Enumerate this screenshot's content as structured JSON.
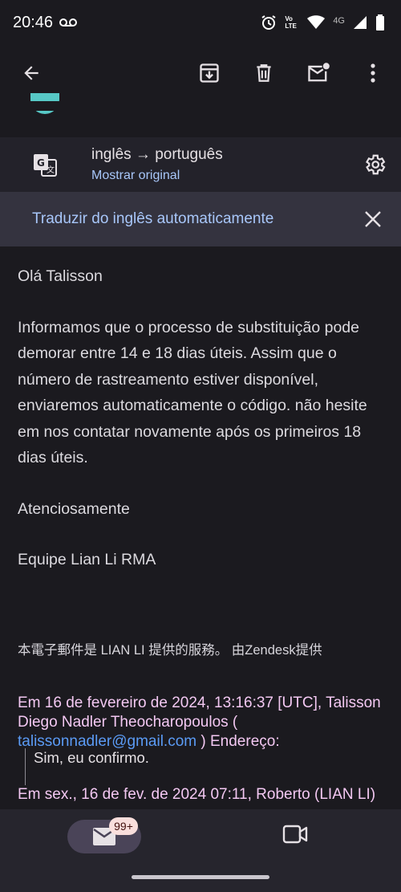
{
  "status_bar": {
    "time": "20:46",
    "network": "4G",
    "volte": "Vo LTE"
  },
  "translation": {
    "languages": "inglês → português",
    "show_original": "Mostrar original",
    "auto_translate": "Traduzir do inglês automaticamente"
  },
  "message": {
    "greeting": "Olá Talisson",
    "paragraph": "Informamos que o processo de substituição pode demorar entre 14 e 18 dias úteis. Assim que o número de rastreamento estiver disponível, enviaremos automaticamente o código. não hesite em nos contatar novamente após os primeiros 18 dias úteis.",
    "closing": "Atenciosamente",
    "signature": "Equipe Lian Li RMA",
    "zendesk_note": "本電子郵件是 LIAN LI 提供的服務。 由Zendesk提供"
  },
  "quoted": {
    "header_prefix": "Em 16 de fevereiro de 2024, 13:16:37 [UTC], Talisson Diego Nadler Theocharopoulos (",
    "email": "talissonnadler@gmail.com",
    "header_suffix": " ) Endereço:",
    "reply": "Sim, eu confirmo.",
    "header2": "Em sex., 16 de fev. de 2024 07:11, Roberto (LIAN LI)"
  },
  "bottom_nav": {
    "mail_badge": "99+"
  },
  "icons": {
    "back": "arrow-back-icon",
    "archive": "archive-icon",
    "delete": "delete-icon",
    "mark_unread": "mark-unread-icon",
    "more": "more-vert-icon",
    "translate": "translate-icon",
    "settings": "gear-icon",
    "close": "close-icon",
    "mail": "mail-icon",
    "video": "video-icon"
  },
  "colors": {
    "background": "#1b1a1f",
    "link_blue": "#a8c7fa",
    "quote_pink": "#f3c8f2",
    "email_link": "#5b9bf5"
  }
}
